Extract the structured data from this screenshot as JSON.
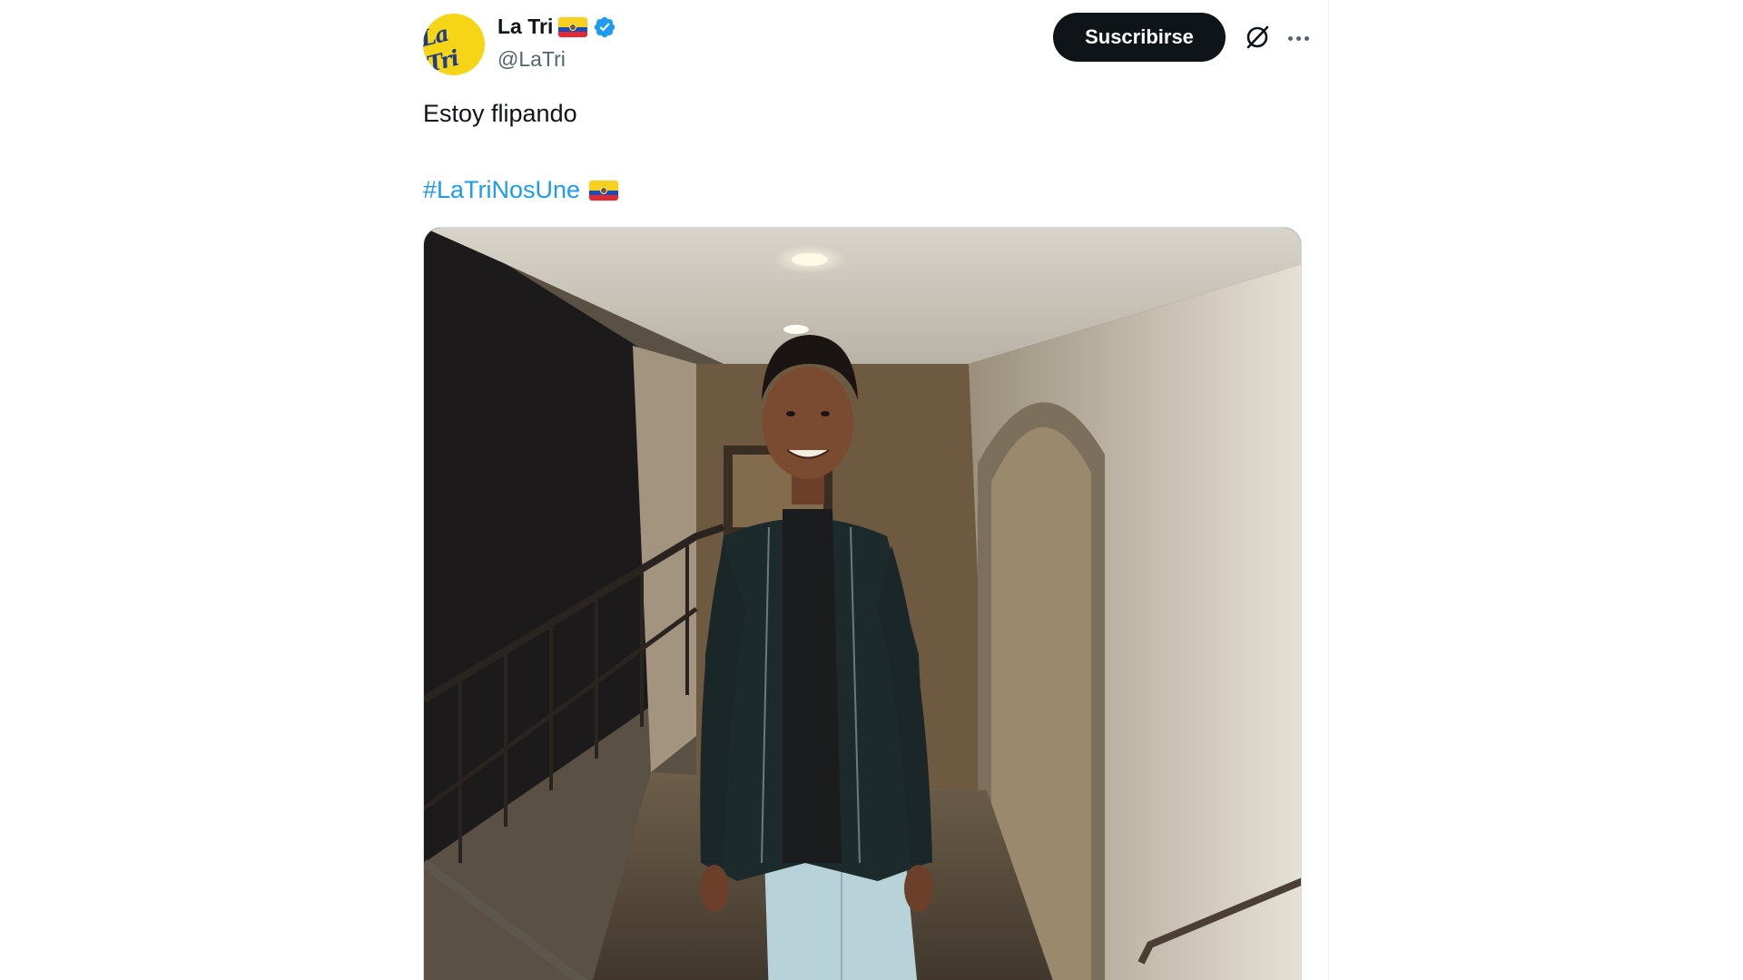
{
  "tweet": {
    "display_name": "La Tri",
    "handle": "@LaTri",
    "avatar_text": "La Tri",
    "name_flag_icon": "ecuador-flag-icon",
    "verified_icon": "verified-badge-icon",
    "subscribe_label": "Suscribirse",
    "grok_icon": "grok-icon",
    "more_icon": "more-options-icon",
    "text": "Estoy flipando",
    "hashtag": "#LaTriNosUne",
    "hashtag_flag_icon": "ecuador-flag-icon",
    "media_icon": "photo-young-man-in-hallway"
  },
  "colors": {
    "text_primary": "#0f1419",
    "text_secondary": "#536471",
    "link": "#1d9bf0",
    "verified": "#1d9bf0",
    "button_bg": "#0f1419",
    "button_text": "#ffffff",
    "avatar_bg": "#f6d516"
  }
}
